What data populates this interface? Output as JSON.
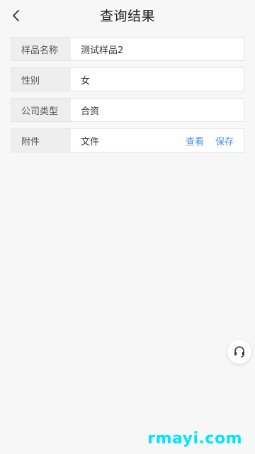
{
  "header": {
    "title": "查询结果",
    "back_icon": "chevron-left-icon"
  },
  "fields": [
    {
      "label": "样品名称",
      "value": "测试样品2"
    },
    {
      "label": "性别",
      "value": "女"
    },
    {
      "label": "公司类型",
      "value": "合资"
    },
    {
      "label": "附件",
      "value": "文件"
    }
  ],
  "attachment_actions": {
    "view_label": "查看",
    "save_label": "保存"
  },
  "support": {
    "icon": "headset-icon"
  },
  "watermark": "rmayi.com",
  "colors": {
    "link": "#4a8fd9",
    "label_bg": "#eeeeee",
    "watermark": "#00e5ff"
  }
}
